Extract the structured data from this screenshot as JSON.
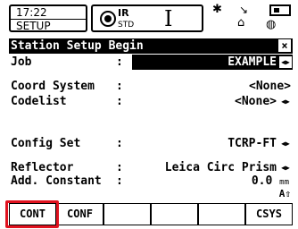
{
  "status": {
    "time": "17:22",
    "mode": "SETUP",
    "measure_mode": "IR",
    "measure_sub": "STD",
    "cursor_glyph": "I",
    "icons": [
      "prism-icon",
      "bluetooth-star-icon",
      "compensator-icon",
      "battery-icon",
      "level-icon",
      "lock-icon"
    ]
  },
  "dialog": {
    "title": "Station Setup Begin",
    "close_label": "×"
  },
  "fields": {
    "job": {
      "label": "Job",
      "value": "EXAMPLE"
    },
    "coord_system": {
      "label": "Coord System",
      "value": "<None>"
    },
    "codelist": {
      "label": "Codelist",
      "value": "<None>"
    },
    "config_set": {
      "label": "Config Set",
      "value": "TCRP-FT"
    },
    "reflector": {
      "label": "Reflector",
      "value": "Leica Circ Prism"
    },
    "add_constant": {
      "label": "Add. Constant",
      "value": "0.0",
      "unit": "mm"
    }
  },
  "shift_indicator": "A⇧",
  "softkeys": [
    "CONT",
    "CONF",
    "",
    "",
    "",
    "CSYS"
  ],
  "colors": {
    "highlight": "#e0121f",
    "title_bg": "#000000"
  }
}
